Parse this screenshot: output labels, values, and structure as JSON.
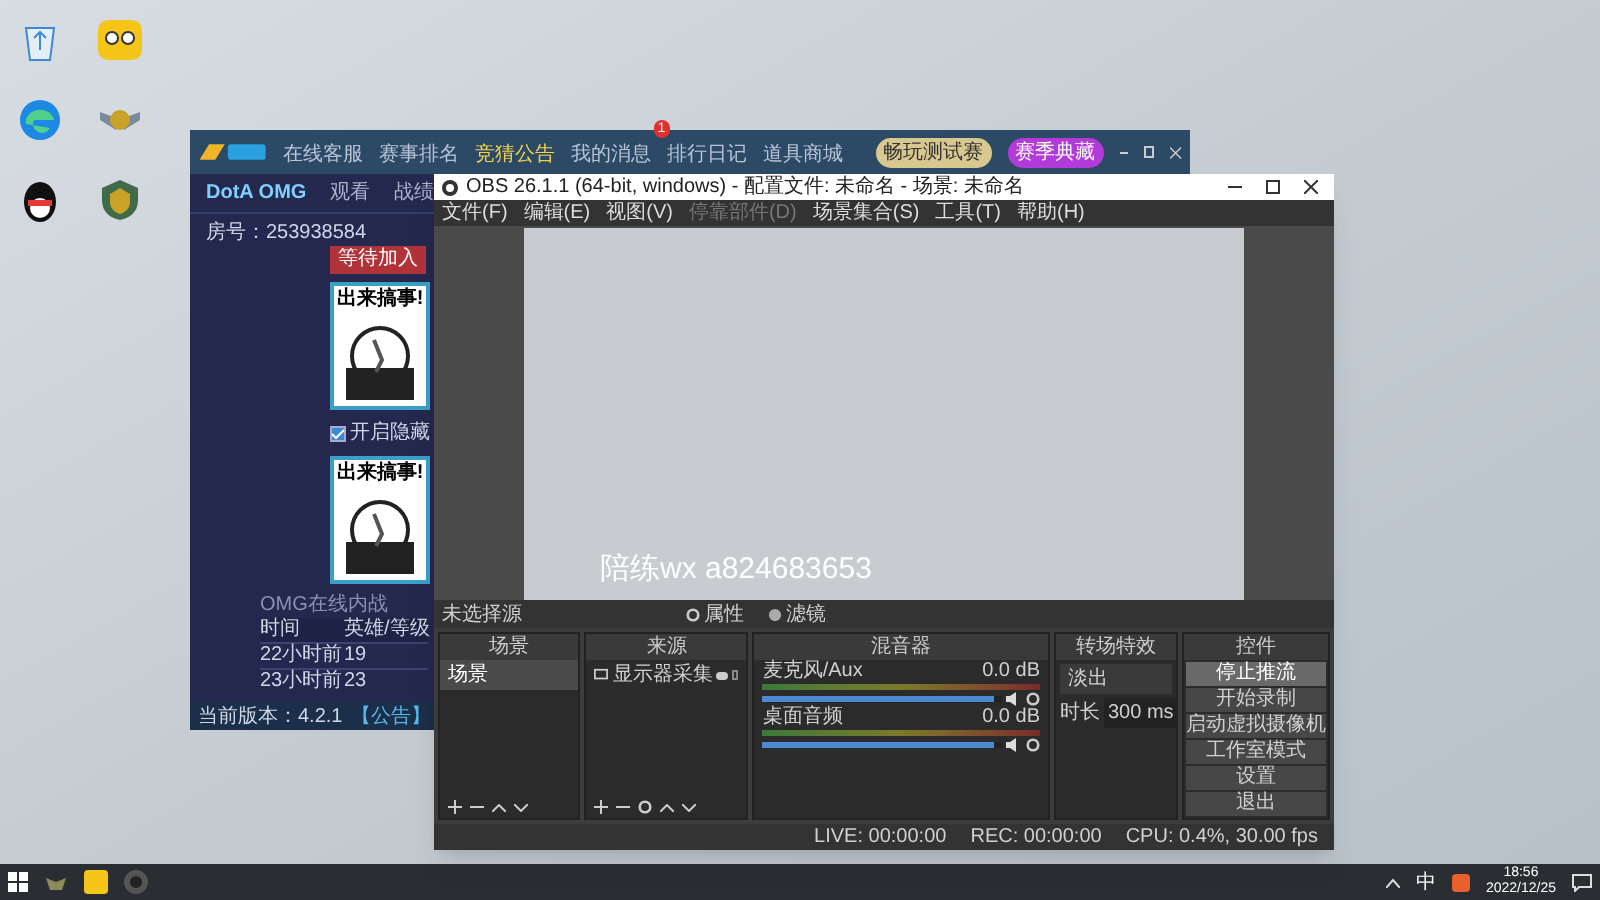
{
  "desktop_icons": [
    {
      "kind": "recycle"
    },
    {
      "kind": "mascot"
    },
    {
      "kind": "edge"
    },
    {
      "kind": "emblem"
    },
    {
      "kind": "qq"
    },
    {
      "kind": "shield"
    }
  ],
  "game_window": {
    "nav": [
      {
        "label": "在线客服",
        "selected": false
      },
      {
        "label": "赛事排名",
        "selected": false
      },
      {
        "label": "竞猜公告",
        "selected": true
      },
      {
        "label": "我的消息",
        "selected": false,
        "badge": "1"
      },
      {
        "label": "排行日记",
        "selected": false
      },
      {
        "label": "道具商城",
        "selected": false
      }
    ],
    "promo_buttons": [
      "畅玩测试赛",
      "赛季典藏"
    ],
    "subtabs": [
      {
        "label": "DotA OMG",
        "selected": true
      },
      {
        "label": "观看",
        "selected": false
      },
      {
        "label": "战绩",
        "selected": false
      }
    ],
    "room": "房号：253938584",
    "wait_button": "等待加入",
    "cards": [
      {
        "caption": "出来搞事!"
      },
      {
        "caption": "出来搞事!"
      }
    ],
    "option": {
      "label": "开启隐藏",
      "checked": true
    },
    "history": {
      "title": "OMG在线内战",
      "columns": [
        "时间",
        "英雄/等级"
      ],
      "rows": [
        [
          "22小时前",
          "19"
        ],
        [
          "23小时前",
          "23"
        ]
      ]
    },
    "version": "当前版本：4.2.1",
    "notice": "【公告】"
  },
  "obs": {
    "title": "OBS 26.1.1 (64-bit, windows) - 配置文件: 未命名 - 场景: 未命名",
    "menu": [
      {
        "label": "文件(F)",
        "disabled": false
      },
      {
        "label": "编辑(E)",
        "disabled": false
      },
      {
        "label": "视图(V)",
        "disabled": false
      },
      {
        "label": "停靠部件(D)",
        "disabled": true
      },
      {
        "label": "场景集合(S)",
        "disabled": false
      },
      {
        "label": "工具(T)",
        "disabled": false
      },
      {
        "label": "帮助(H)",
        "disabled": false
      }
    ],
    "source_bar": {
      "status": "未选择源",
      "buttons": [
        "属性",
        "滤镜"
      ]
    },
    "scenes": {
      "title": "场景",
      "items": [
        {
          "label": "场景",
          "selected": true
        }
      ]
    },
    "sources": {
      "title": "来源",
      "items": [
        {
          "label": "显示器采集",
          "visible": true,
          "locked": false
        }
      ]
    },
    "mixer": {
      "title": "混音器",
      "channels": [
        {
          "name": "麦克风/Aux",
          "reading": "0.0 dB",
          "level": 0.97,
          "muted": false
        },
        {
          "name": "桌面音频",
          "reading": "0.0 dB",
          "level": 0.97,
          "muted": false
        }
      ]
    },
    "transitions": {
      "title": "转场特效",
      "type": "淡出",
      "duration_label": "时长",
      "duration": "300 ms"
    },
    "controls": {
      "title": "控件",
      "buttons": [
        {
          "label": "停止推流",
          "selected": true
        },
        {
          "label": "开始录制",
          "selected": false
        },
        {
          "label": "启动虚拟摄像机",
          "selected": false
        },
        {
          "label": "工作室模式",
          "selected": false
        },
        {
          "label": "设置",
          "selected": false
        },
        {
          "label": "退出",
          "selected": false
        }
      ]
    },
    "status": {
      "live": "LIVE: 00:00:00",
      "rec": "REC: 00:00:00",
      "cpu": "CPU: 0.4%, 30.00 fps"
    }
  },
  "overlay_text": "陪练wx a824683653",
  "taskbar": {
    "tray_ime": "中",
    "time": "18:56",
    "date": "2022/12/25"
  }
}
